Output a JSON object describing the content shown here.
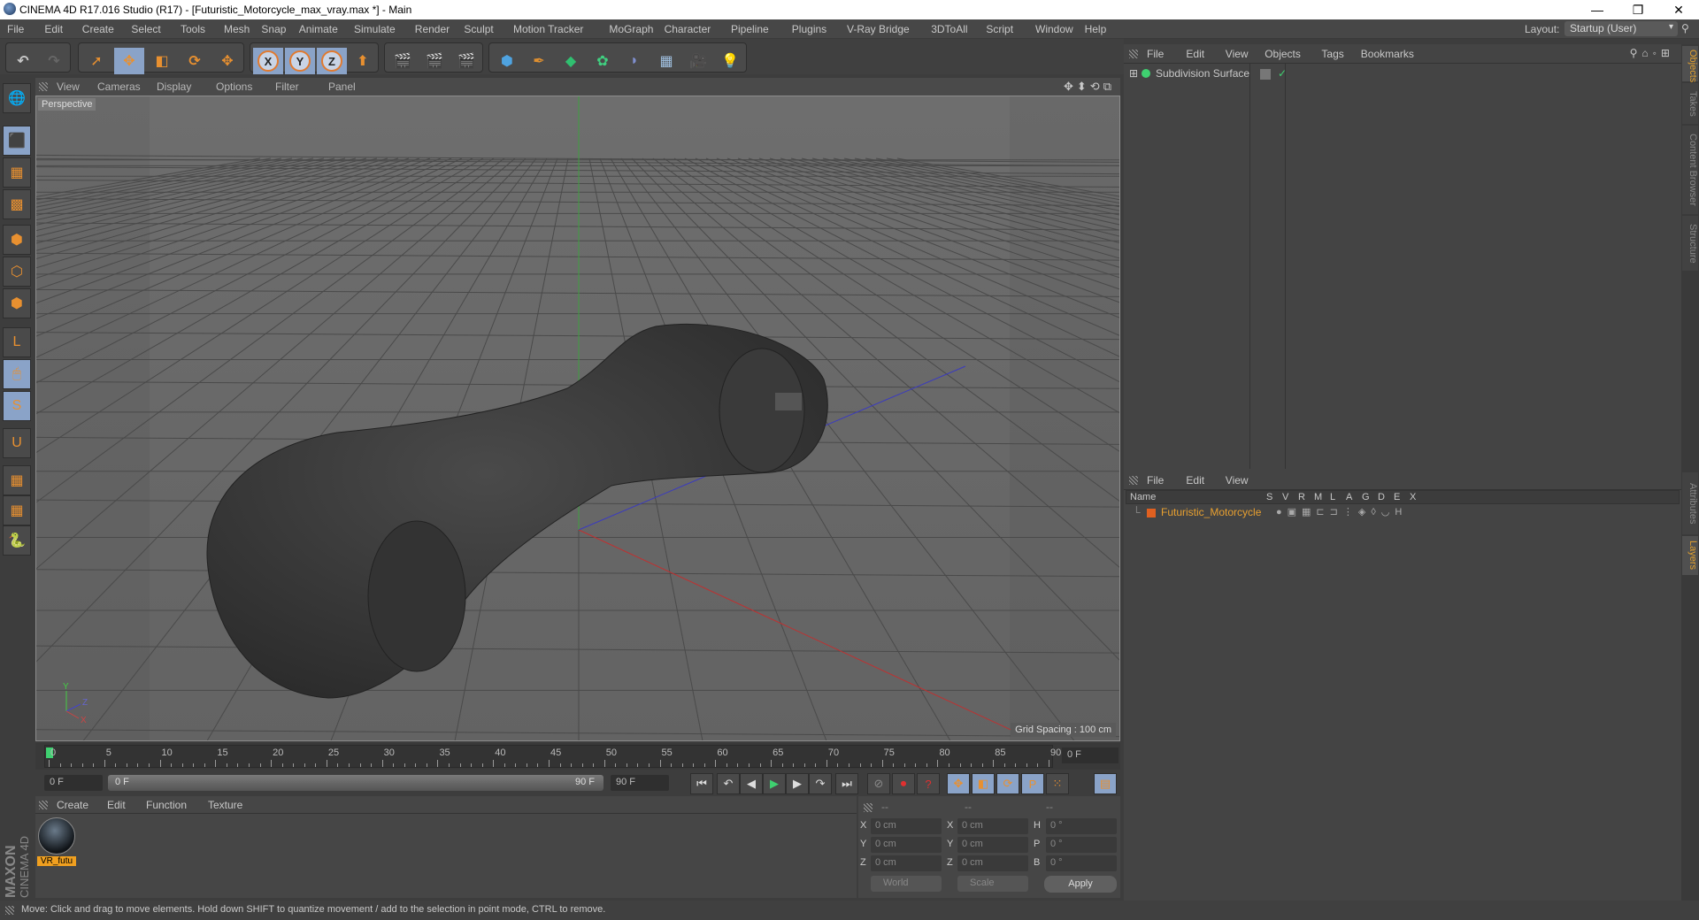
{
  "window": {
    "title": "CINEMA 4D R17.016 Studio (R17) - [Futuristic_Motorcycle_max_vray.max *] - Main",
    "controls": {
      "minimize": "—",
      "maximize": "❐",
      "close": "✕"
    }
  },
  "menubar": {
    "items": [
      "File",
      "Edit",
      "Create",
      "Select",
      "Tools",
      "Mesh",
      "Snap",
      "Animate",
      "Simulate",
      "Render",
      "Sculpt",
      "Motion Tracker",
      "MoGraph",
      "Character",
      "Pipeline",
      "Plugins",
      "V-Ray Bridge",
      "3DToAll",
      "Script",
      "Window",
      "Help"
    ],
    "layout_label": "Layout:",
    "layout_value": "Startup (User)"
  },
  "toolbar": {
    "undo": "↶",
    "redo": "↷",
    "tools": [
      {
        "name": "live-selection",
        "glyph": "➚",
        "selected": false
      },
      {
        "name": "move",
        "glyph": "✥",
        "selected": true
      },
      {
        "name": "scale",
        "glyph": "◧",
        "selected": false
      },
      {
        "name": "rotate",
        "glyph": "⟳",
        "selected": false
      },
      {
        "name": "recent-tool",
        "glyph": "✥",
        "selected": false
      }
    ],
    "axes": [
      "X",
      "Y",
      "Z"
    ],
    "coord_system_glyph": "⬆",
    "render": [
      "🎬",
      "🎬",
      "🎬"
    ],
    "create": [
      {
        "name": "cube",
        "glyph": "⬢",
        "color": "#4fa3e0"
      },
      {
        "name": "pen",
        "glyph": "✒",
        "color": "#e09030"
      },
      {
        "name": "subdivision",
        "glyph": "◆",
        "color": "#30c070"
      },
      {
        "name": "cloner",
        "glyph": "✿",
        "color": "#40d080"
      },
      {
        "name": "deformer",
        "glyph": "◗",
        "color": "#8090d0"
      },
      {
        "name": "floor",
        "glyph": "▦",
        "color": "#a0c0e0"
      },
      {
        "name": "camera",
        "glyph": "🎥",
        "color": "#222"
      },
      {
        "name": "light",
        "glyph": "💡",
        "color": "#eee"
      }
    ]
  },
  "lefttools": [
    "⬛",
    "▦",
    "▩",
    "⬢",
    "⬡",
    "⬢",
    "L",
    "🖱",
    "S",
    "U",
    "▦",
    "▦",
    "🐍"
  ],
  "viewport": {
    "menu": [
      "View",
      "Cameras",
      "Display",
      "Options",
      "Filter",
      "Panel"
    ],
    "camera_label": "Perspective",
    "grid_spacing": "Grid Spacing : 100 cm",
    "nav_icons": [
      "✥",
      "⬍",
      "⟲",
      "⧉"
    ]
  },
  "timeline": {
    "ticks": [
      0,
      5,
      10,
      15,
      20,
      25,
      30,
      35,
      40,
      45,
      50,
      55,
      60,
      65,
      70,
      75,
      80,
      85,
      90
    ],
    "current_frame": "0 F",
    "start_field": "0 F",
    "range_start": "0 F",
    "range_end": "90 F",
    "end_field": "90 F"
  },
  "transport": {
    "buttons": [
      "⏮",
      "↶",
      "◀",
      "▶",
      "▶",
      "↷",
      "⏭"
    ],
    "record": [
      "⊘",
      "⏺",
      "?"
    ],
    "keys": [
      "✥",
      "◧",
      "⟳",
      "P",
      "⁙"
    ],
    "timeline_btn": "▤"
  },
  "material_panel": {
    "menu": [
      "Create",
      "Edit",
      "Function",
      "Texture"
    ],
    "materials": [
      {
        "label": "VR_futu"
      }
    ]
  },
  "coordinates": {
    "headers": [
      "--",
      "--",
      "--"
    ],
    "rows": [
      {
        "a": "X",
        "v1": "0 cm",
        "b": "X",
        "v2": "0 cm",
        "c": "H",
        "v3": "0 °"
      },
      {
        "a": "Y",
        "v1": "0 cm",
        "b": "Y",
        "v2": "0 cm",
        "c": "P",
        "v3": "0 °"
      },
      {
        "a": "Z",
        "v1": "0 cm",
        "b": "Z",
        "v2": "0 cm",
        "c": "B",
        "v3": "0 °"
      }
    ],
    "space": "World",
    "mode": "Scale",
    "apply": "Apply"
  },
  "object_manager": {
    "menu": [
      "File",
      "Edit",
      "View",
      "Objects",
      "Tags",
      "Bookmarks"
    ],
    "objects": [
      {
        "name": "Subdivision Surface",
        "check": "✓"
      }
    ]
  },
  "layer_manager": {
    "menu": [
      "File",
      "Edit",
      "View"
    ],
    "columns": [
      "Name",
      "S",
      "V",
      "R",
      "M",
      "L",
      "A",
      "G",
      "D",
      "E",
      "X"
    ],
    "layers": [
      {
        "name": "Futuristic_Motorcycle",
        "color": "#e06020"
      }
    ]
  },
  "side_tabs": {
    "top": [
      {
        "label": "Objects",
        "active": true
      },
      {
        "label": "Takes",
        "active": false
      },
      {
        "label": "Content Browser",
        "active": false
      },
      {
        "label": "Structure",
        "active": false
      }
    ],
    "bottom": [
      {
        "label": "Attributes",
        "active": false
      },
      {
        "label": "Layers",
        "active": true
      }
    ]
  },
  "branding": {
    "line1": "MAXON",
    "line2": "CINEMA 4D"
  },
  "status": "Move: Click and drag to move elements. Hold down SHIFT to quantize movement / add to the selection in point mode, CTRL to remove."
}
